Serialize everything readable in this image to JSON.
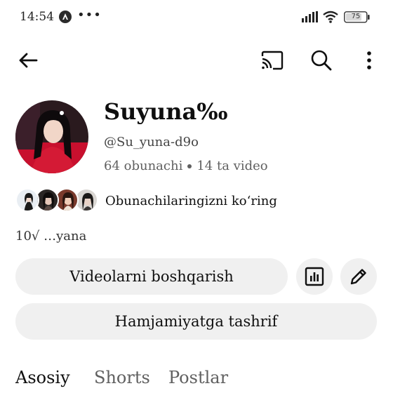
{
  "status_bar": {
    "time": "14:54",
    "more": "•••",
    "battery": "75"
  },
  "top_bar": {
    "icons": [
      "arrow-left-icon",
      "cast-icon",
      "search-icon",
      "more-vert-icon"
    ]
  },
  "channel": {
    "name": "Suyuna‰",
    "handle": "@Su_yuna-d9o",
    "subscribers": "64 obunachi",
    "videos": "14 ta video",
    "subscribers_link": "Obunachilaringizni koʻring",
    "description_preview": "10√ …yana"
  },
  "actions": {
    "manage_videos": "Videolarni boshqarish",
    "visit_community": "Hamjamiyatga tashrif"
  },
  "tabs": [
    {
      "label": "Asosiy",
      "active": true
    },
    {
      "label": "Shorts",
      "active": false
    },
    {
      "label": "Postlar",
      "active": false
    }
  ],
  "colors": {
    "button_bg": "#f0f0f0",
    "text_primary": "#0f0f0f",
    "text_secondary": "#606060",
    "avatar_accent": "#c8102e"
  }
}
